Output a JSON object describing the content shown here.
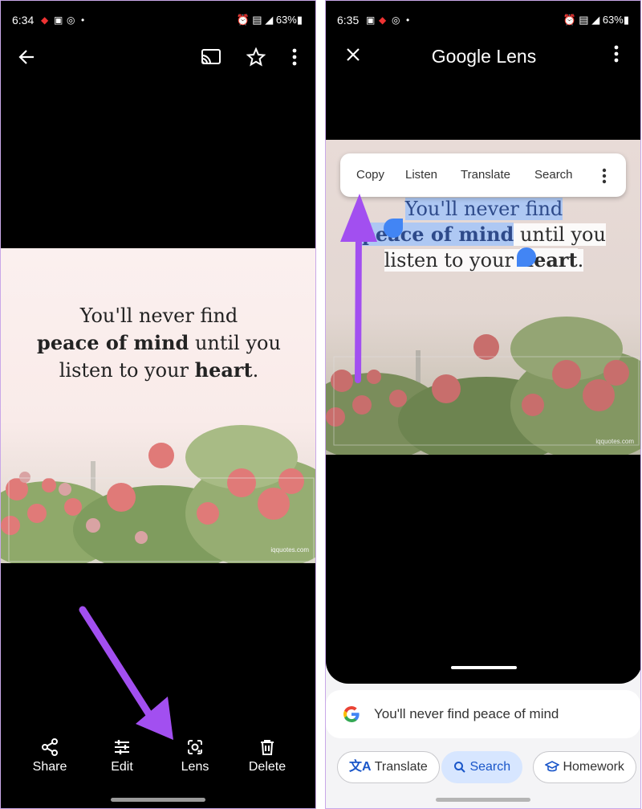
{
  "left": {
    "status": {
      "time": "6:34",
      "battery": "63%"
    },
    "quote": {
      "line1": "You'll never find",
      "line2_bold": "peace of mind",
      "line2_rest": " until you",
      "line3_start": "listen to your ",
      "line3_bold": "heart",
      "line3_end": "."
    },
    "watermark": "iqquotes.com",
    "actions": {
      "share": "Share",
      "edit": "Edit",
      "lens": "Lens",
      "delete": "Delete"
    }
  },
  "right": {
    "status": {
      "time": "6:35",
      "battery": "63%"
    },
    "title": "Google Lens",
    "popup": {
      "copy": "Copy",
      "listen": "Listen",
      "translate": "Translate",
      "search": "Search"
    },
    "quote": {
      "line1": "You'll never find",
      "line2_bold": "peace of mind",
      "line2_rest": " until you",
      "line3_start": "listen to your ",
      "line3_bold": "heart",
      "line3_end": "."
    },
    "watermark": "iqquotes.com",
    "result_text": "You'll never find peace of mind",
    "chips": {
      "translate": "Translate",
      "search": "Search",
      "homework": "Homework"
    }
  },
  "colors": {
    "accent_arrow": "#a24ff0",
    "selection": "#a0c3fa",
    "chip_active": "#d7e6ff"
  }
}
